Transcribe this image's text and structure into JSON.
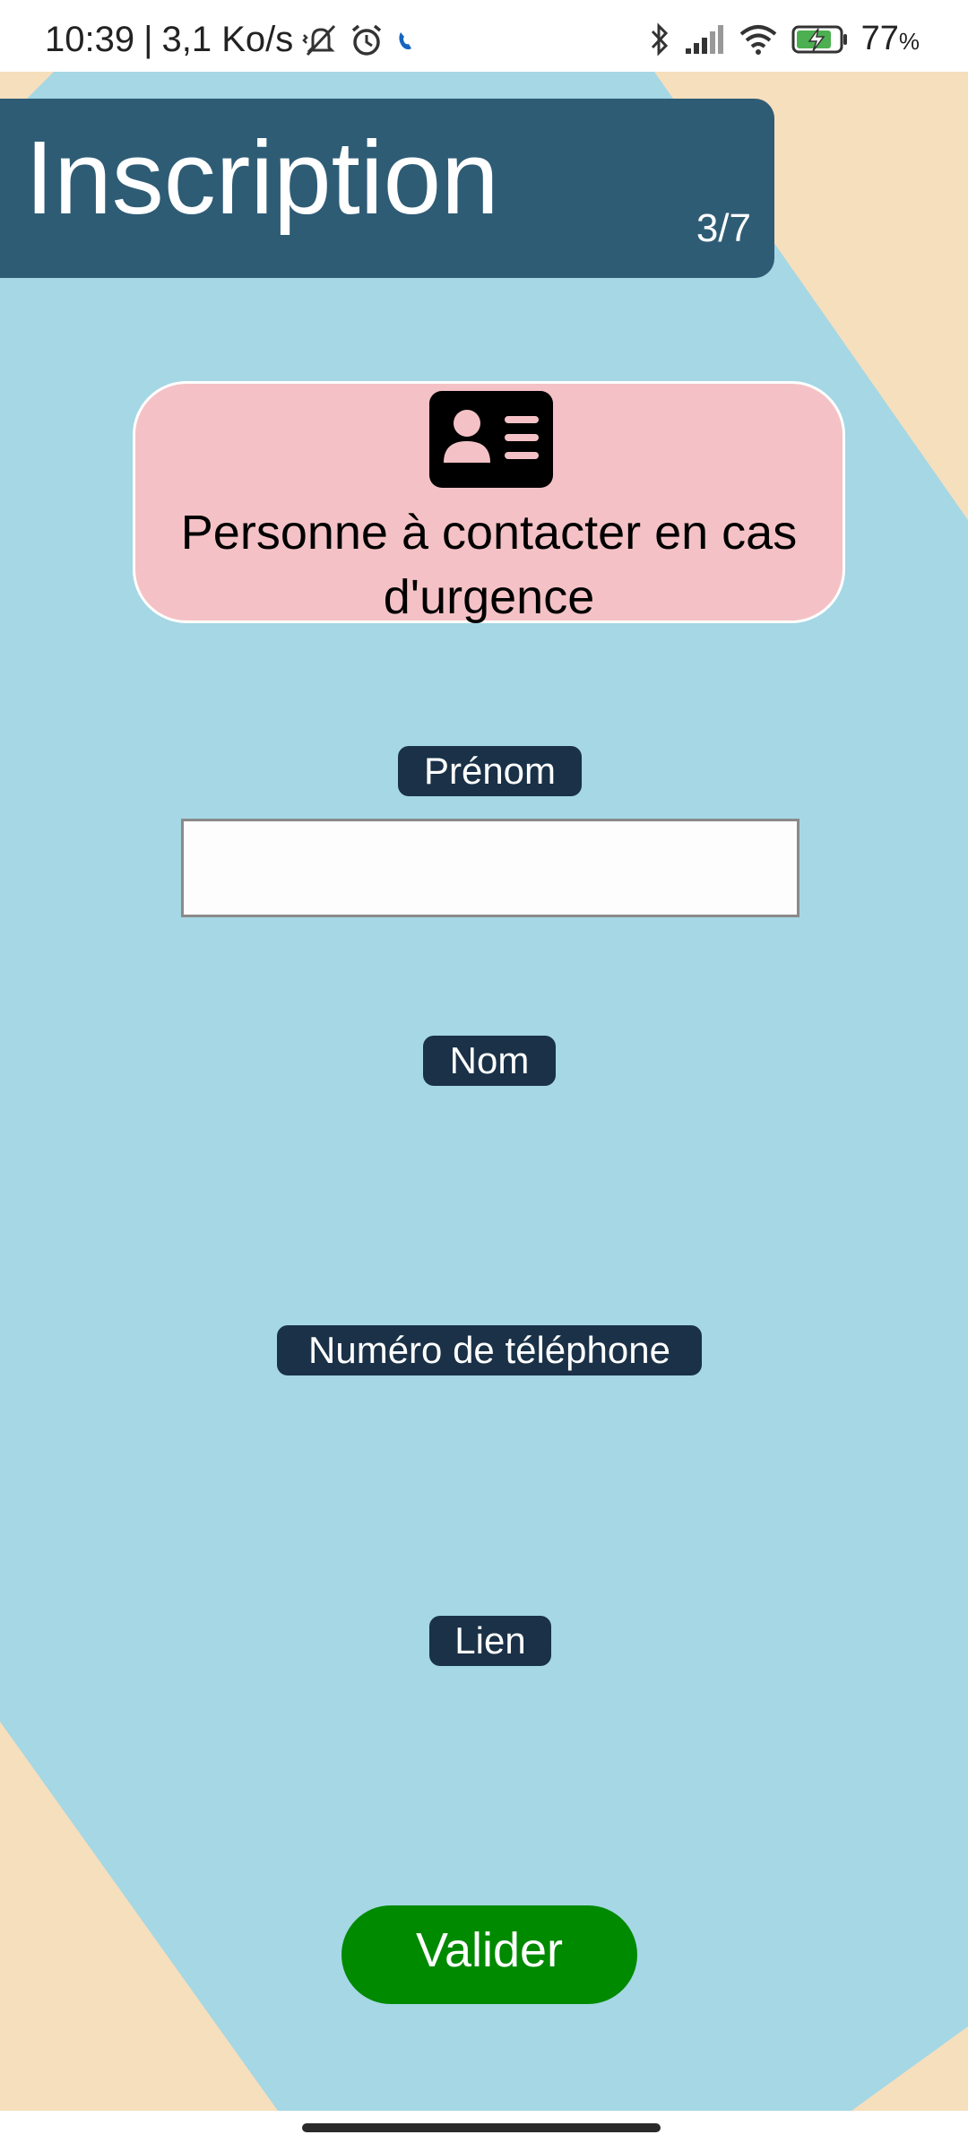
{
  "status_bar": {
    "time": "10:39",
    "speed": "3,1 Ko/s",
    "battery": "77",
    "battery_unit": "%",
    "icons": [
      "mute-vibrate-icon",
      "alarm-icon",
      "call-icon",
      "bluetooth-icon",
      "signal-icon",
      "wifi-icon",
      "battery-charging-icon"
    ]
  },
  "header": {
    "title": "Inscription",
    "step": "3/7"
  },
  "section": {
    "icon": "contact-card-icon",
    "title": "Personne à contacter en cas d'urgence"
  },
  "form": {
    "first_name_label": "Prénom",
    "first_name_value": "",
    "last_name_label": "Nom",
    "phone_label": "Numéro de téléphone",
    "relation_label": "Lien"
  },
  "submit_label": "Valider",
  "colors": {
    "background": "#a5d7e5",
    "accent_shape": "#f6dfbd",
    "header": "#2e5c75",
    "card": "#f4c2c6",
    "label": "#1a3147",
    "button": "#008a00"
  }
}
